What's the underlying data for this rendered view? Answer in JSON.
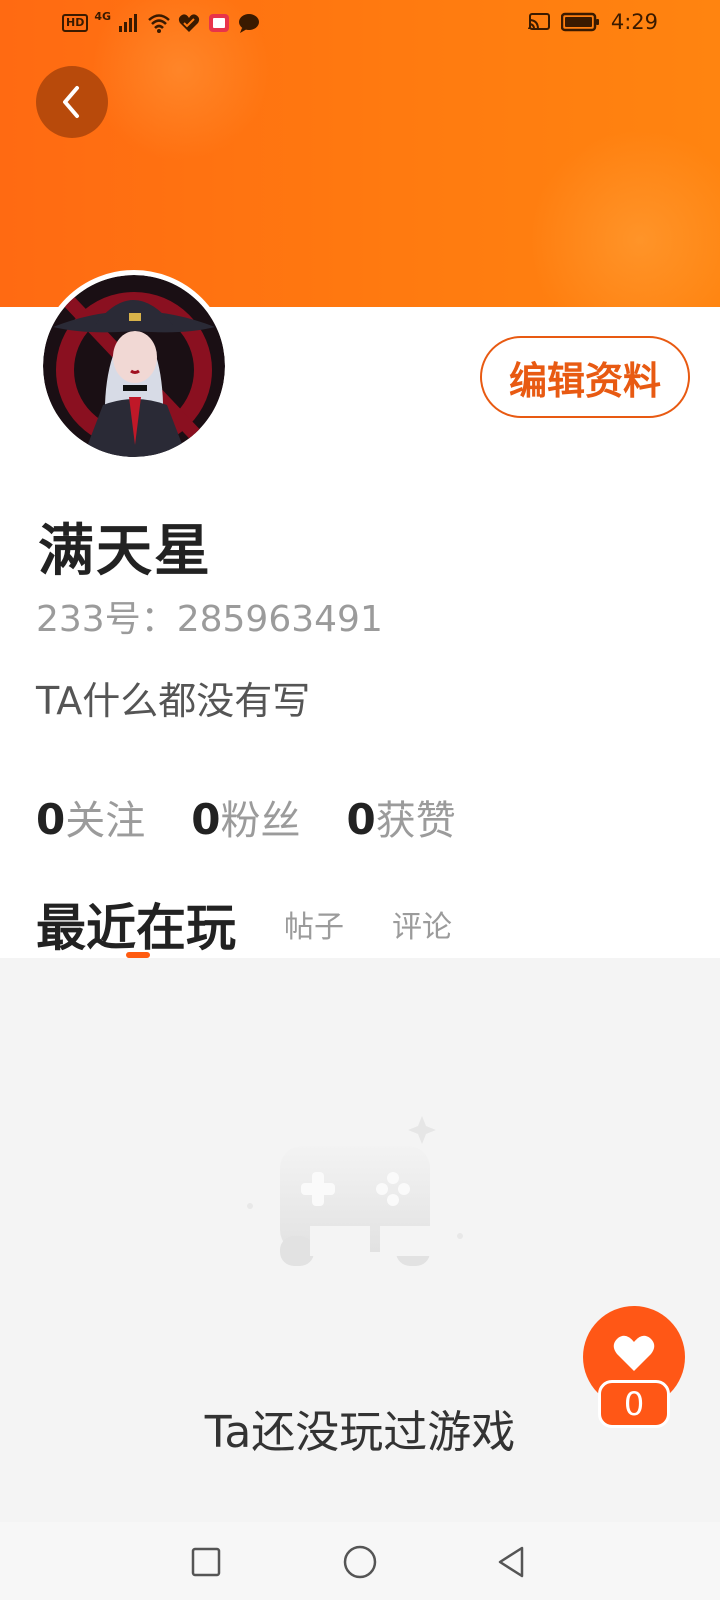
{
  "status_bar": {
    "left_badges": [
      "HD",
      "4G"
    ],
    "icons": [
      "signal-icon",
      "wifi-icon",
      "heart-app-icon",
      "book-app-icon",
      "message-app-icon",
      "cast-icon",
      "battery-icon"
    ],
    "time": "4:29"
  },
  "header": {
    "back_icon": "chevron-left-icon",
    "edit_button_label": "编辑资料"
  },
  "profile": {
    "username": "满天星",
    "uid_text": "233号：285963491",
    "bio": "TA什么都没有写"
  },
  "stats": [
    {
      "num": "0",
      "label": "关注"
    },
    {
      "num": "0",
      "label": "粉丝"
    },
    {
      "num": "0",
      "label": "获赞"
    }
  ],
  "tabs": [
    {
      "label": "最近在玩",
      "active": true
    },
    {
      "label": "帖子",
      "active": false
    },
    {
      "label": "评论",
      "active": false
    }
  ],
  "empty_state": {
    "icon": "gamepad-icon",
    "text": "Ta还没玩过游戏"
  },
  "like_fab": {
    "icon": "heart-icon",
    "count": "0"
  },
  "colors": {
    "accent": "#ff5b10",
    "header_orange": "#ff7a10",
    "edit_border": "#e85a12"
  },
  "nav_bar": {
    "buttons": [
      "square-icon",
      "circle-icon",
      "triangle-back-icon"
    ]
  }
}
